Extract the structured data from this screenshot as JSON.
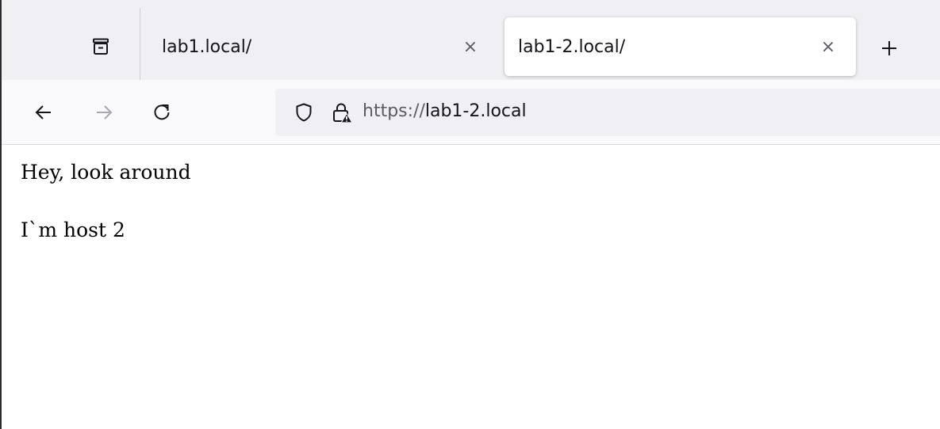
{
  "tabs": [
    {
      "label": "lab1.local/",
      "active": false
    },
    {
      "label": "lab1-2.local/",
      "active": true
    }
  ],
  "tab_close_glyph": "×",
  "new_tab_icon": "plus-icon",
  "nav": {
    "back_icon": "arrow-left-icon",
    "forward_icon": "arrow-right-icon",
    "reload_icon": "reload-icon",
    "forward_enabled": false
  },
  "urlbar": {
    "scheme": "https://",
    "host": "lab1-2.local",
    "tracking_icon": "shield-icon",
    "security_icon": "lock-warning-icon"
  },
  "page": {
    "lines": [
      "Hey, look around",
      "I`m host 2"
    ]
  },
  "colors": {
    "tabstrip_bg": "#f0f0f4",
    "navbar_bg": "#f9f9fb",
    "urlbar_bg": "#f0f0f4",
    "text": "#15141a",
    "muted": "#5b5b66",
    "warning": "#e22850"
  }
}
